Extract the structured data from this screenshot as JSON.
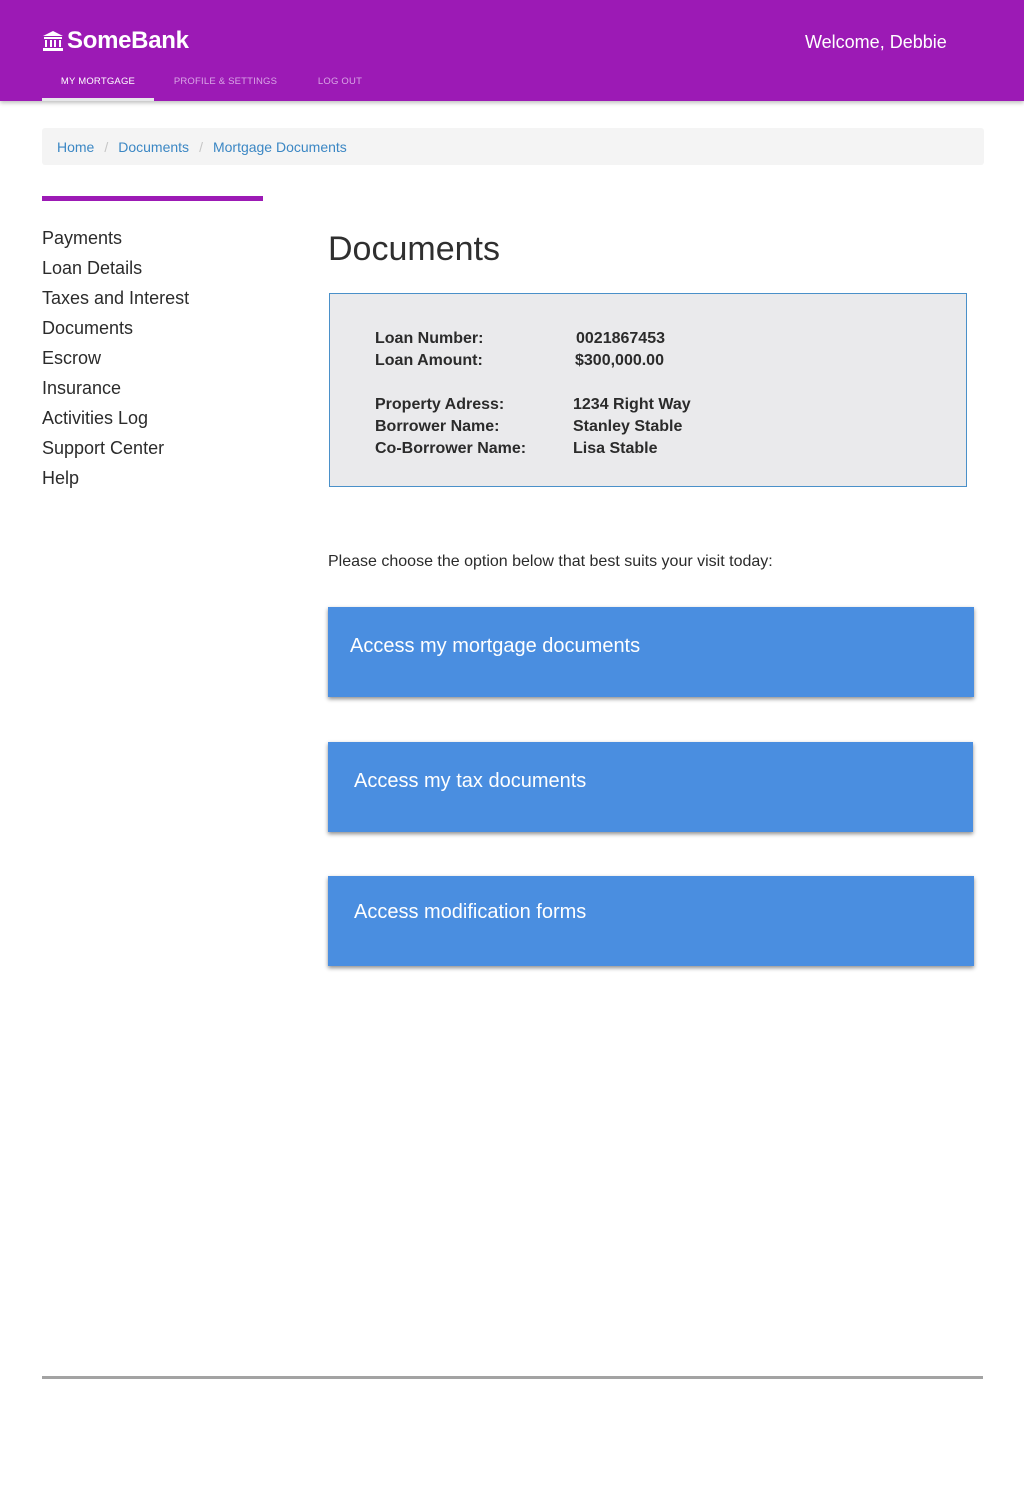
{
  "header": {
    "brand": "SomeBank",
    "welcome": "Welcome, Debbie",
    "tabs": [
      {
        "label": "MY MORTGAGE",
        "active": true
      },
      {
        "label": "PROFILE & SETTINGS",
        "active": false
      },
      {
        "label": "LOG OUT",
        "active": false
      }
    ]
  },
  "breadcrumb": [
    "Home",
    "Documents",
    "Mortgage Documents"
  ],
  "breadcrumb_separator": "/",
  "sidebar": {
    "items": [
      {
        "label": "Payments"
      },
      {
        "label": "Loan Details"
      },
      {
        "label": "Taxes and Interest"
      },
      {
        "label": "Documents"
      },
      {
        "label": "Escrow"
      },
      {
        "label": "Insurance"
      },
      {
        "label": "Activities Log"
      },
      {
        "label": "Support Center"
      },
      {
        "label": "Help"
      }
    ]
  },
  "main": {
    "title": "Documents",
    "loan_info": {
      "loan_number_label": "Loan Number:",
      "loan_number": "0021867453",
      "loan_amount_label": "Loan Amount:",
      "loan_amount": "$300,000.00",
      "property_label": "Property Adress:",
      "property": "1234 Right Way",
      "borrower_label": "Borrower Name:",
      "borrower": "Stanley Stable",
      "coborrower_label": "Co-Borrower Name:",
      "coborrower": "Lisa Stable"
    },
    "prompt": "Please choose the option below that best suits your visit today:",
    "actions": [
      {
        "label": "Access my mortgage documents"
      },
      {
        "label": "Access my tax documents"
      },
      {
        "label": "Access modification forms"
      }
    ]
  },
  "colors": {
    "brand_purple": "#9c1ab5",
    "action_blue": "#4a8ee0",
    "link_blue": "#3b87c4"
  },
  "icons": {
    "brand": "bank-icon"
  }
}
